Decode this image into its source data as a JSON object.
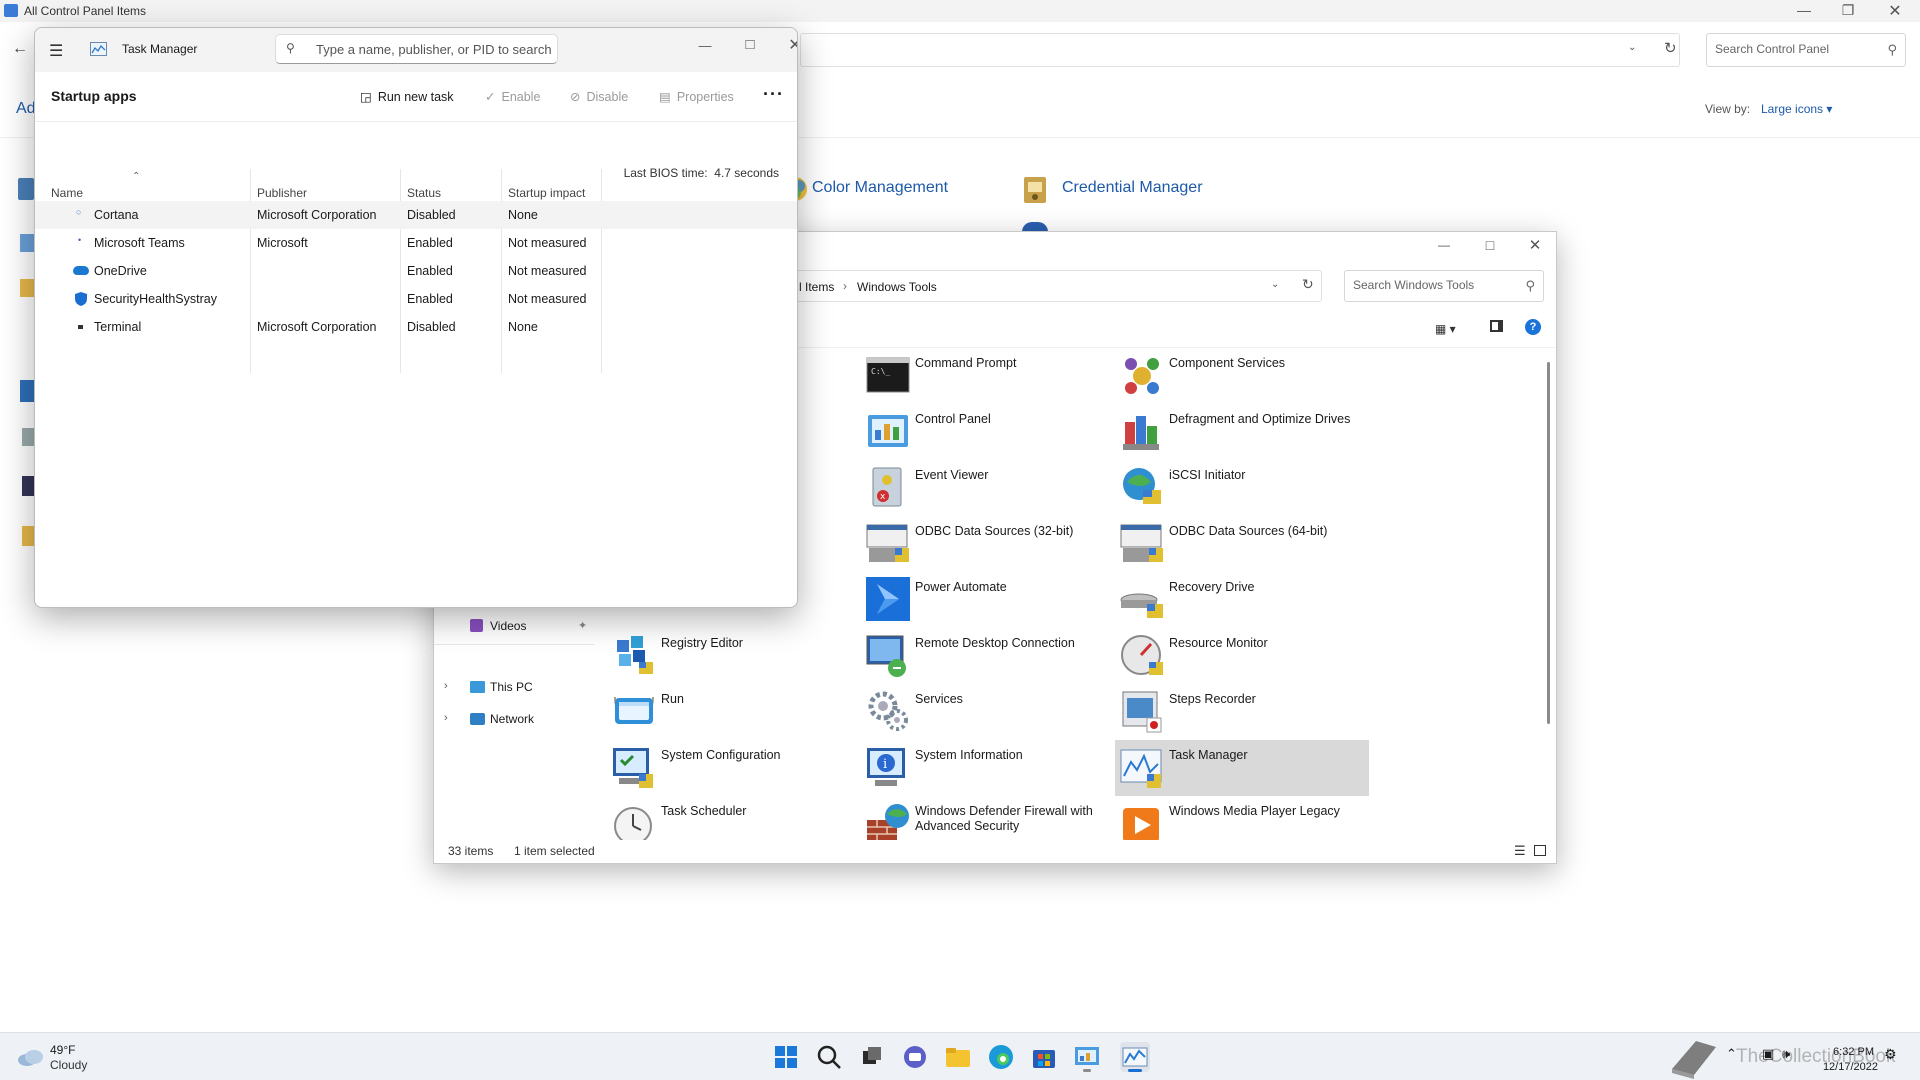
{
  "control_panel": {
    "title": "All Control Panel Items",
    "search_placeholder": "Search Control Panel",
    "left_fragment": "Ad",
    "view_by_label": "View by:",
    "view_by_value": "Large icons",
    "items": [
      "Color Management",
      "Credential Manager"
    ]
  },
  "windows_tools": {
    "breadcrumb": [
      "l Items",
      "Windows Tools"
    ],
    "search_placeholder": "Search Windows Tools",
    "nav": {
      "pinned": "Videos",
      "this_pc": "This PC",
      "network": "Network"
    },
    "status": {
      "count": "33 items",
      "selected": "1 item selected"
    },
    "tiles": [
      {
        "label": "Command Prompt",
        "icon": "command-prompt-icon"
      },
      {
        "label": "Component Services",
        "icon": "component-services-icon"
      },
      {
        "label": "Control Panel",
        "icon": "control-panel-icon"
      },
      {
        "label": "Defragment and Optimize Drives",
        "icon": "defragment-icon"
      },
      {
        "label": "Event Viewer",
        "icon": "event-viewer-icon"
      },
      {
        "label": "iSCSI Initiator",
        "icon": "iscsi-icon"
      },
      {
        "label": "ODBC Data Sources (32-bit)",
        "icon": "odbc-icon"
      },
      {
        "label": "ODBC Data Sources (64-bit)",
        "icon": "odbc-icon"
      },
      {
        "label": "Power Automate",
        "icon": "power-automate-icon"
      },
      {
        "label": "Recovery Drive",
        "icon": "recovery-drive-icon"
      },
      {
        "label": "Registry Editor",
        "icon": "registry-editor-icon"
      },
      {
        "label": "Remote Desktop Connection",
        "icon": "remote-desktop-icon"
      },
      {
        "label": "Resource Monitor",
        "icon": "resource-monitor-icon"
      },
      {
        "label": "Run",
        "icon": "run-icon"
      },
      {
        "label": "Services",
        "icon": "services-icon"
      },
      {
        "label": "Steps Recorder",
        "icon": "steps-recorder-icon"
      },
      {
        "label": "System Configuration",
        "icon": "system-configuration-icon"
      },
      {
        "label": "System Information",
        "icon": "system-information-icon"
      },
      {
        "label": "Task Manager",
        "icon": "task-manager-icon"
      },
      {
        "label": "Task Scheduler",
        "icon": "task-scheduler-icon"
      },
      {
        "label": "Windows Defender Firewall with Advanced Security",
        "icon": "firewall-icon"
      },
      {
        "label": "Windows Media Player Legacy",
        "icon": "media-player-icon"
      }
    ]
  },
  "task_manager": {
    "title": "Task Manager",
    "search_placeholder": "Type a name, publisher, or PID to search",
    "page_title": "Startup apps",
    "commands": {
      "run_new_task": "Run new task",
      "enable": "Enable",
      "disable": "Disable",
      "properties": "Properties"
    },
    "bios_label": "Last BIOS time:",
    "bios_value": "4.7 seconds",
    "columns": [
      "Name",
      "Publisher",
      "Status",
      "Startup impact"
    ],
    "rows": [
      {
        "name": "Cortana",
        "publisher": "Microsoft Corporation",
        "status": "Disabled",
        "impact": "None"
      },
      {
        "name": "Microsoft Teams",
        "publisher": "Microsoft",
        "status": "Enabled",
        "impact": "Not measured"
      },
      {
        "name": "OneDrive",
        "publisher": "",
        "status": "Enabled",
        "impact": "Not measured"
      },
      {
        "name": "SecurityHealthSystray",
        "publisher": "",
        "status": "Enabled",
        "impact": "Not measured"
      },
      {
        "name": "Terminal",
        "publisher": "Microsoft Corporation",
        "status": "Disabled",
        "impact": "None"
      }
    ]
  },
  "taskbar": {
    "weather_temp": "49°F",
    "weather_desc": "Cloudy",
    "time": "6:32 PM",
    "date": "12/17/2022",
    "watermark": "TheCollectionBook"
  },
  "colors": {
    "accent": "#0067c0",
    "link": "#1e5aa8",
    "selection": "#d9d9d9"
  }
}
